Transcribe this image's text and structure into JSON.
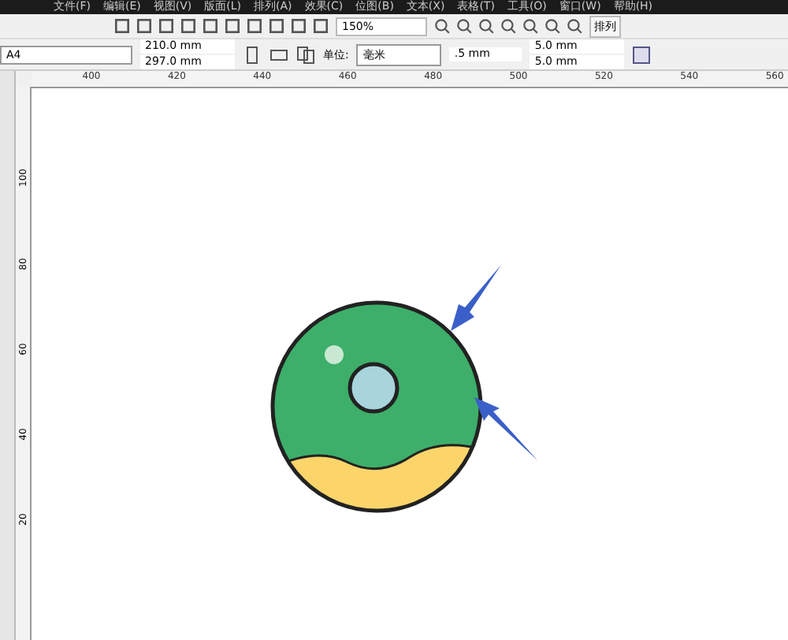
{
  "menu": [
    "文件(F)",
    "编辑(E)",
    "视图(V)",
    "版面(L)",
    "排列(A)",
    "效果(C)",
    "位图(B)",
    "文本(X)",
    "表格(T)",
    "工具(O)",
    "窗口(W)",
    "帮助(H)"
  ],
  "toolbar": {
    "zoom": "150%",
    "extra": "排列"
  },
  "property_bar": {
    "page_size": "A4",
    "width": "210.0 mm",
    "height": "297.0 mm",
    "units_label": "单位:",
    "units": "毫米",
    "nudge": ".5 mm",
    "dup_x": "5.0 mm",
    "dup_y": "5.0 mm"
  },
  "h_ruler": [
    "400",
    "420",
    "440",
    "460",
    "480",
    "500",
    "520",
    "540",
    "560"
  ],
  "v_ruler": [
    "100",
    "80",
    "60",
    "40",
    "20"
  ]
}
